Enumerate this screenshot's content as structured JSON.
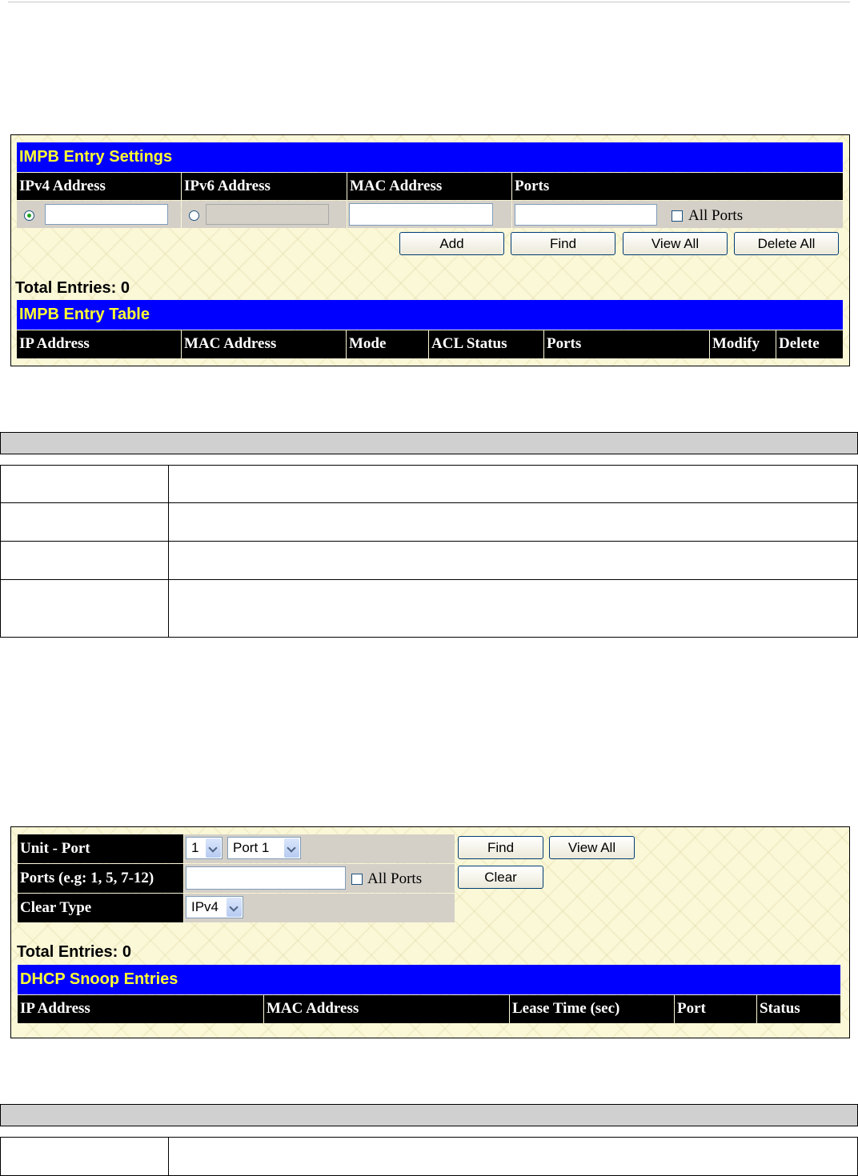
{
  "impb": {
    "settings_title": "IMPB Entry Settings",
    "headers": [
      "IPv4 Address",
      "IPv6 Address",
      "MAC Address",
      "Ports"
    ],
    "all_ports_label": "All Ports",
    "buttons": {
      "add": "Add",
      "find": "Find",
      "view_all": "View All",
      "delete_all": "Delete All"
    },
    "total_entries": "Total Entries: 0",
    "table_title": "IMPB Entry Table",
    "table_headers": [
      "IP Address",
      "MAC Address",
      "Mode",
      "ACL Status",
      "Ports",
      "Modify",
      "Delete"
    ]
  },
  "dhcp": {
    "labels": {
      "unit_port": "Unit - Port",
      "ports": "Ports (e.g: 1, 5, 7-12)",
      "clear_type": "Clear Type"
    },
    "unit_select": "1",
    "port_select": "Port 1",
    "all_ports_label": "All Ports",
    "clear_type_select": "IPv4",
    "buttons": {
      "find": "Find",
      "view_all": "View All",
      "clear": "Clear"
    },
    "total_entries": "Total Entries: 0",
    "table_title": "DHCP Snoop Entries",
    "table_headers": [
      "IP Address",
      "MAC Address",
      "Lease Time (sec)",
      "Port",
      "Status"
    ]
  }
}
